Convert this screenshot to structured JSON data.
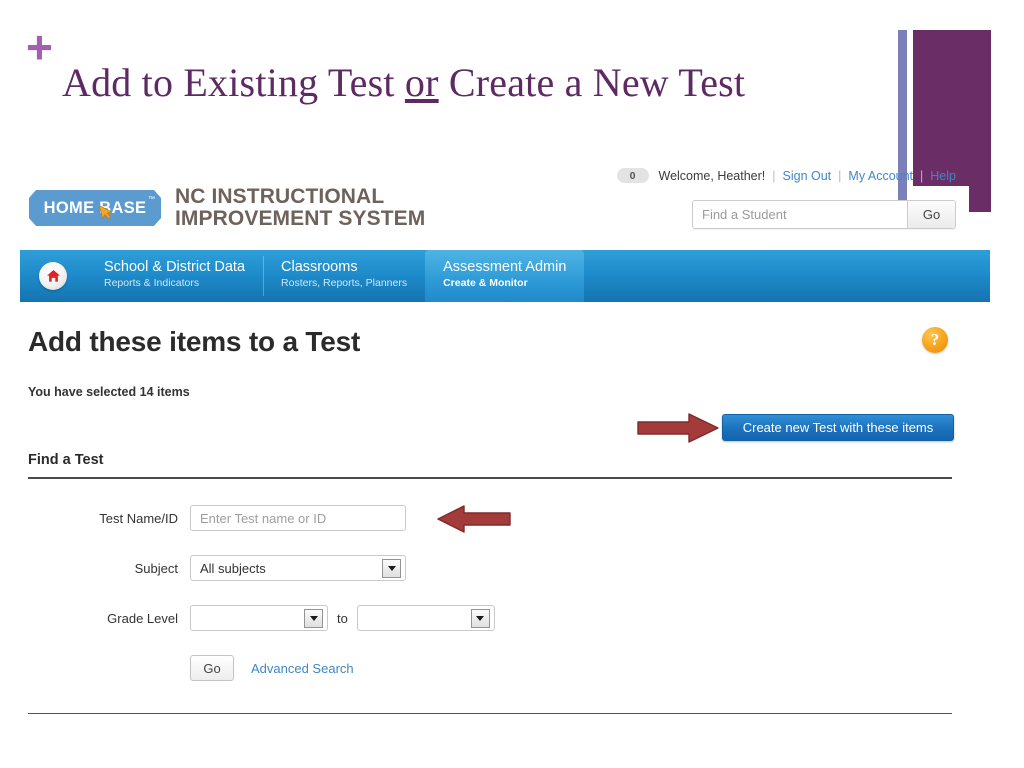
{
  "slide": {
    "bullet": "+",
    "title_part1": "Add to Existing Test ",
    "title_emphasis": "or",
    "title_part2": " Create a New Test"
  },
  "colors": {
    "slide_title": "#5e2a63",
    "slide_plus": "#a45fb0",
    "deco_purple": "#6b2d66",
    "deco_blue": "#7b80b8",
    "nav_blue": "#1f8ccb",
    "link_blue": "#3f87c6",
    "button_blue": "#1d73bf",
    "arrow_red": "#a33b3b",
    "help_orange": "#f5a21e"
  },
  "header": {
    "logo_text": "HOME BASE",
    "logo_tm": "™",
    "logo_cursor_icon": "cursor-arrow-icon",
    "system_name_line1": "NC INSTRUCTIONAL",
    "system_name_line2": "IMPROVEMENT SYSTEM",
    "alert_count": "0",
    "welcome": "Welcome, Heather!",
    "links": [
      {
        "label": "Sign Out",
        "name": "sign-out-link"
      },
      {
        "label": "My Account",
        "name": "my-account-link"
      },
      {
        "label": "Help",
        "name": "help-link"
      }
    ],
    "separator": "|",
    "student_search": {
      "placeholder": "Find a Student",
      "value": "",
      "go_label": "Go"
    }
  },
  "nav": {
    "home_icon": "home-icon",
    "items": [
      {
        "title": "School & District Data",
        "sub": "Reports & Indicators",
        "active": false
      },
      {
        "title": "Classrooms",
        "sub": "Rosters, Reports, Planners",
        "active": false
      },
      {
        "title": "Assessment Admin",
        "sub": "Create & Monitor",
        "active": true
      }
    ]
  },
  "page": {
    "title": "Add these items to a Test",
    "help_glyph": "?",
    "selected_count_text": "You have selected 14 items",
    "create_button_label": "Create new Test with these items",
    "section_heading": "Find a Test"
  },
  "form": {
    "test_name": {
      "label": "Test Name/ID",
      "placeholder": "Enter Test name or ID",
      "value": ""
    },
    "subject": {
      "label": "Subject",
      "value": "All subjects"
    },
    "grade_level": {
      "label": "Grade Level",
      "from_value": "",
      "to_word": "to",
      "to_value": ""
    },
    "go_label": "Go",
    "advanced_search_label": "Advanced Search"
  },
  "annotations": {
    "arrow_to_create_button": "right-arrow-annotation",
    "arrow_to_test_name": "left-arrow-annotation"
  }
}
